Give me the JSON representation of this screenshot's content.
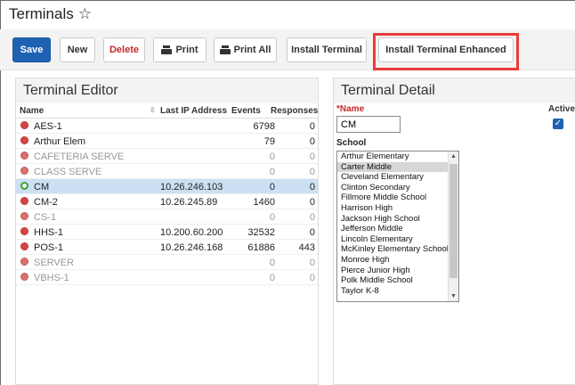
{
  "page": {
    "title": "Terminals"
  },
  "toolbar": {
    "save": "Save",
    "new": "New",
    "delete": "Delete",
    "print": "Print",
    "print_all": "Print All",
    "install_terminal": "Install Terminal",
    "install_terminal_enhanced": "Install Terminal Enhanced"
  },
  "editor": {
    "title": "Terminal Editor",
    "columns": {
      "name": "Name",
      "ip": "Last IP Address",
      "events": "Events",
      "responses": "Responses"
    },
    "rows": [
      {
        "name": "AES-1",
        "ip": "",
        "events": "6798",
        "responses": "0",
        "status": "error"
      },
      {
        "name": "Arthur Elem",
        "ip": "",
        "events": "79",
        "responses": "0",
        "status": "error"
      },
      {
        "name": "CAFETERIA SERVE",
        "ip": "",
        "events": "0",
        "responses": "0",
        "status": "inactive"
      },
      {
        "name": "CLASS SERVE",
        "ip": "",
        "events": "0",
        "responses": "0",
        "status": "inactive"
      },
      {
        "name": "CM",
        "ip": "10.26.246.103",
        "events": "0",
        "responses": "0",
        "status": "active"
      },
      {
        "name": "CM-2",
        "ip": "10.26.245.89",
        "events": "1460",
        "responses": "0",
        "status": "error"
      },
      {
        "name": "CS-1",
        "ip": "",
        "events": "0",
        "responses": "0",
        "status": "inactive"
      },
      {
        "name": "HHS-1",
        "ip": "10.200.60.200",
        "events": "32532",
        "responses": "0",
        "status": "error"
      },
      {
        "name": "POS-1",
        "ip": "10.26.246.168",
        "events": "61886",
        "responses": "443",
        "status": "error"
      },
      {
        "name": "SERVER",
        "ip": "",
        "events": "0",
        "responses": "0",
        "status": "inactive"
      },
      {
        "name": "VBHS-1",
        "ip": "",
        "events": "0",
        "responses": "0",
        "status": "inactive"
      }
    ]
  },
  "detail": {
    "title": "Terminal Detail",
    "name_label": "*Name",
    "name_value": "CM",
    "active_label": "Active",
    "school_label": "School",
    "schools": [
      "Arthur Elementary",
      "Carter Middle",
      "Cleveland Elementary",
      "Clinton Secondary",
      "Fillmore Middle School",
      "Harrison High",
      "Jackson High School",
      "Jefferson Middle",
      "Lincoln Elementary",
      "McKinley Elementary School",
      "Monroe High",
      "Pierce Junior High",
      "Polk Middle School",
      "Taylor K-8"
    ],
    "selected_school": "Carter Middle"
  },
  "colors": {
    "primary": "#1f62b4",
    "delete": "#c62828",
    "highlight": "#ec3a3a",
    "selected_row": "#cde0f3",
    "status_error": "#d64545",
    "status_active": "#35a535"
  }
}
